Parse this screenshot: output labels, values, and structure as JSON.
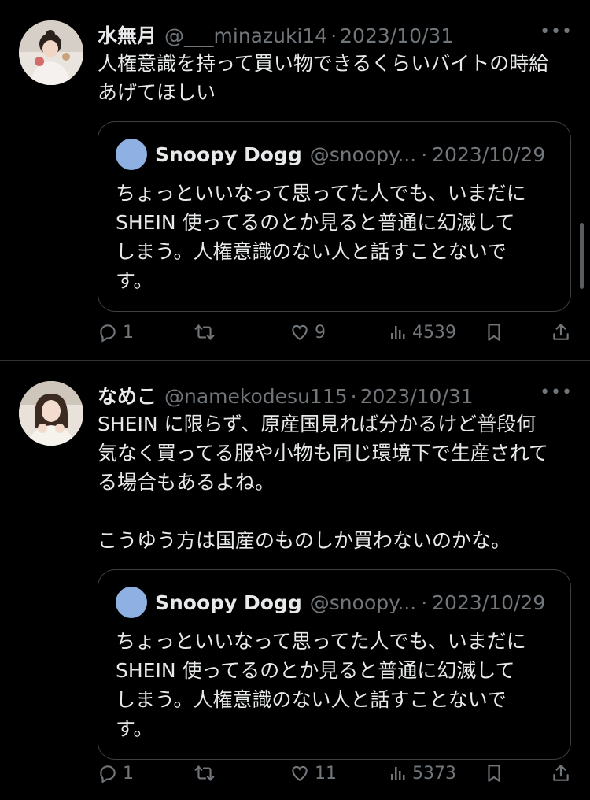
{
  "tweets": [
    {
      "name": "水無月",
      "handle": "@___minazuki14",
      "sep": "·",
      "date": "2023/10/31",
      "more": "•••",
      "text": "人権意識を持って買い物できるくらいバイトの時給\nあげてほしい",
      "quote": {
        "name": "Snoopy Dogg",
        "handle": "@snoopy...",
        "sep": "·",
        "date": "2023/10/29",
        "text": "ちょっといいなって思ってた人でも、いまだに\nSHEIN 使ってるのとか見ると普通に幻滅して\nしまう。人権意識のない人と話すことないで\nす。"
      },
      "replies": "1",
      "retweets": "",
      "likes": "9",
      "views": "4539"
    },
    {
      "name": "なめこ",
      "handle": "@namekodesu115",
      "sep": "·",
      "date": "2023/10/31",
      "more": "•••",
      "text": "SHEIN に限らず、原産国見れば分かるけど普段何\n気なく買ってる服や小物も同じ環境下で生産されて\nる場合もあるよね。\n\nこうゆう方は国産のものしか買わないのかな。",
      "quote": {
        "name": "Snoopy Dogg",
        "handle": "@snoopy...",
        "sep": "·",
        "date": "2023/10/29",
        "text": "ちょっといいなって思ってた人でも、いまだに\nSHEIN 使ってるのとか見ると普通に幻滅して\nしまう。人権意識のない人と話すことないで\nす。"
      },
      "replies": "1",
      "retweets": "",
      "likes": "11",
      "views": "5373"
    }
  ],
  "icons": [
    "reply-icon",
    "retweet-icon",
    "like-icon",
    "views-icon",
    "bookmark-icon",
    "share-icon",
    "more-icon"
  ],
  "colors": {
    "background": "#000000",
    "text": "#e7e9ea",
    "muted": "#71767b",
    "border": "#2f3336",
    "quote_avatar": "#8fb0e3"
  }
}
